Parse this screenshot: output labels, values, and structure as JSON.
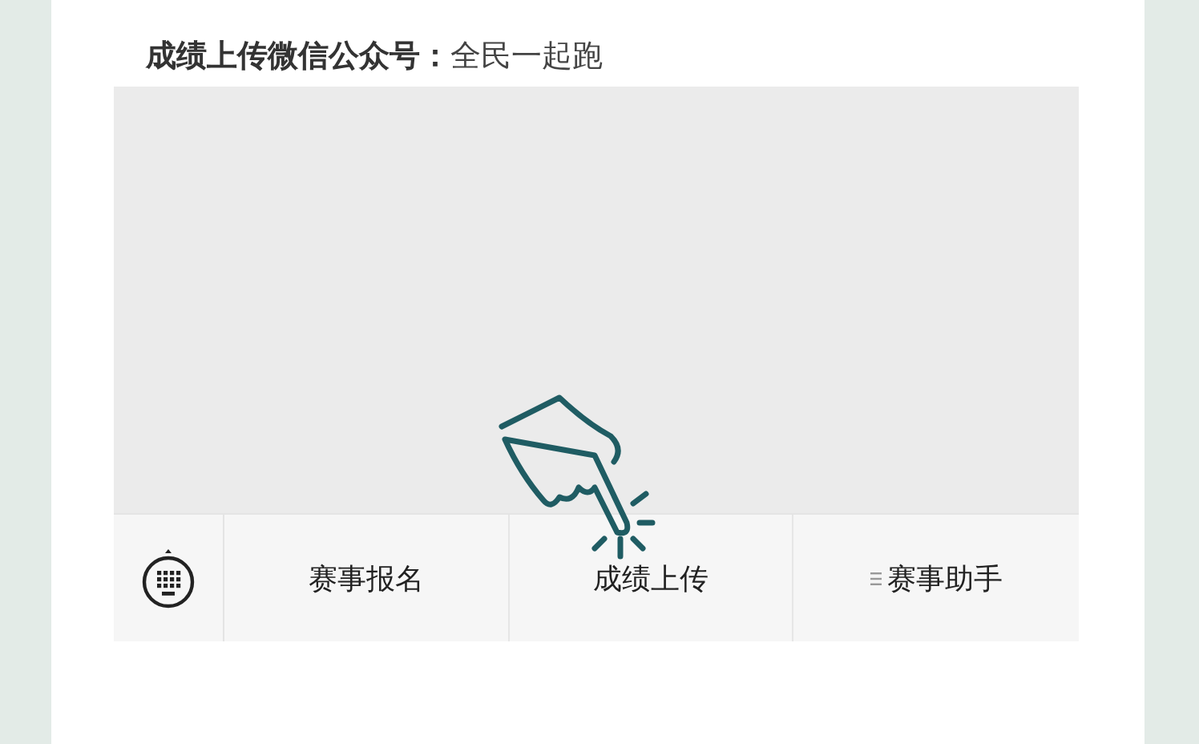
{
  "heading": {
    "label": "成绩上传微信公众号：",
    "value": "全民一起跑"
  },
  "menu_bar": {
    "items": [
      {
        "label": "赛事报名",
        "kind": "plain"
      },
      {
        "label": "成绩上传",
        "kind": "plain"
      },
      {
        "label": "赛事助手",
        "kind": "submenu"
      }
    ]
  }
}
